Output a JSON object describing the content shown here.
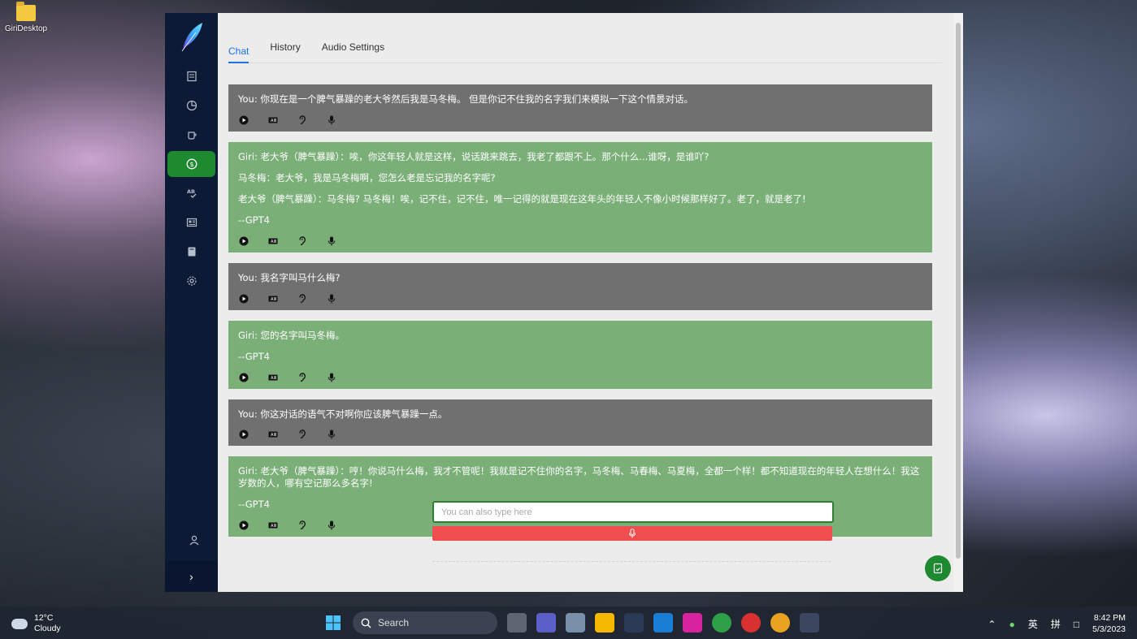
{
  "desktop": {
    "icon_label": "GiriDesktop"
  },
  "tabs": [
    "Chat",
    "History",
    "Audio Settings"
  ],
  "messages": [
    {
      "role": "user",
      "lines": [
        "You: 你现在是一个脾气暴躁的老大爷然后我是马冬梅。 但是你记不住我的名字我们来模拟一下这个情景对话。"
      ]
    },
    {
      "role": "bot",
      "lines": [
        "Giri: 老大爷（脾气暴躁）：唉，你这年轻人就是这样，说话跳来跳去，我老了都跟不上。那个什么...谁呀，是谁吖?",
        "马冬梅：老大爷，我是马冬梅啊，您怎么老是忘记我的名字呢?",
        "老大爷（脾气暴躁）：马冬梅? 马冬梅！唉，记不住，记不住，唯一记得的就是现在这年头的年轻人不像小时候那样好了。老了，就是老了!",
        "--GPT4"
      ]
    },
    {
      "role": "user",
      "lines": [
        "You: 我名字叫马什么梅?"
      ]
    },
    {
      "role": "bot",
      "lines": [
        "Giri: 您的名字叫马冬梅。",
        "--GPT4"
      ]
    },
    {
      "role": "user",
      "lines": [
        "You: 你这对话的语气不对啊你应该脾气暴躁一点。"
      ]
    },
    {
      "role": "bot",
      "lines": [
        "Giri: 老大爷（脾气暴躁）：哼！你说马什么梅，我才不管呢！我就是记不住你的名字，马冬梅、马春梅、马夏梅，全都一个样！都不知道现在的年轻人在想什么！我这岁数的人，哪有空记那么多名字!",
        "--GPT4"
      ]
    }
  ],
  "input": {
    "placeholder": "You can also type here"
  },
  "taskbar": {
    "temp": "12°C",
    "weather": "Cloudy",
    "search_label": "Search",
    "ime1": "英",
    "ime2": "拼",
    "time": "8:42 PM",
    "date": "5/3/2023"
  },
  "colors": {
    "user_bubble": "#707070",
    "bot_bubble": "#7aaf78",
    "accent": "#1e8a2f",
    "sidebar": "#0c1a35",
    "mic_bar": "#f04e4e"
  }
}
